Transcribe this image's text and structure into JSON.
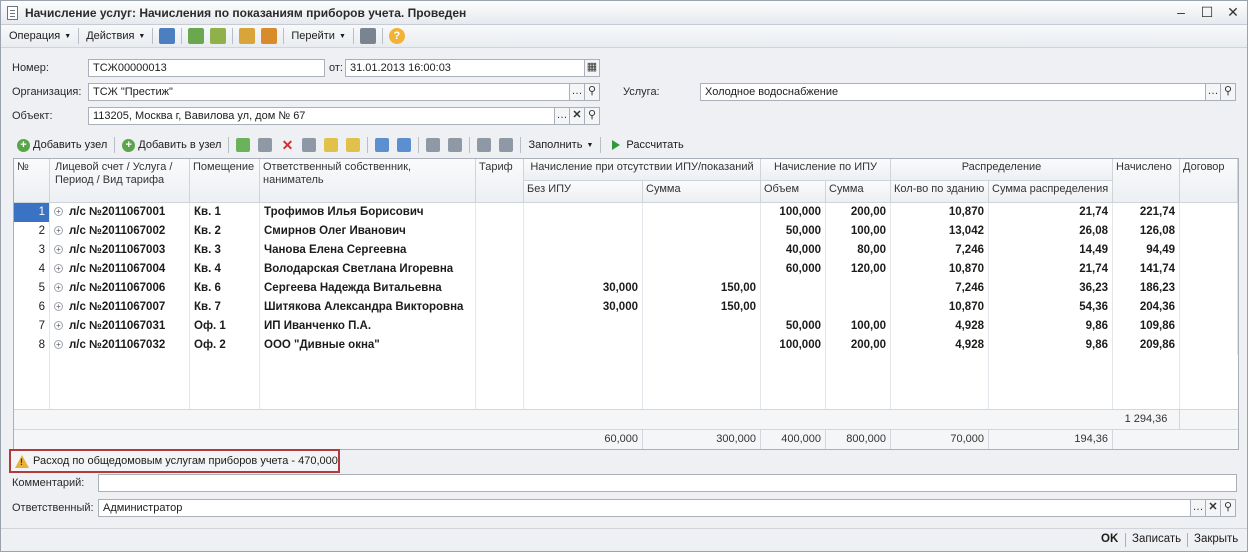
{
  "window": {
    "title": "Начисление услуг: Начисления по показаниям приборов учета. Проведен"
  },
  "toolbar": {
    "operation": "Операция",
    "actions": "Действия",
    "goto": "Перейти"
  },
  "form": {
    "number_label": "Номер:",
    "number": "ТСЖ00000013",
    "date_label": "от:",
    "date": "31.01.2013 16:00:03",
    "org_label": "Организация:",
    "org": "ТСЖ \"Престиж\"",
    "service_label": "Услуга:",
    "service": "Холодное водоснабжение",
    "object_label": "Объект:",
    "object": "113205, Москва г, Вавилова ул, дом № 67"
  },
  "gridbar": {
    "add_node": "Добавить узел",
    "add_to_node": "Добавить в узел",
    "fill": "Заполнить",
    "calculate": "Рассчитать"
  },
  "columns": {
    "num": "№",
    "account": "Лицевой счет / Услуга / Период / Вид тарифа",
    "room": "Помещение",
    "owner": "Ответственный собственник, наниматель",
    "tariff": "Тариф",
    "no_ipu": "Начисление при отсутствии ИПУ/показаний",
    "no_ipu_without": "Без ИПУ",
    "no_ipu_sum": "Сумма",
    "ipu": "Начисление по ИПУ",
    "ipu_volume": "Объем",
    "ipu_sum": "Сумма",
    "distribution": "Распределение",
    "dist_qty": "Кол-во по зданию",
    "dist_sum": "Сумма распределения",
    "charged": "Начислено",
    "contract": "Договор"
  },
  "rows": [
    {
      "n": "1",
      "account": "л/с №2011067001",
      "room": "Кв. 1",
      "owner": "Трофимов Илья Борисович",
      "noipu": "",
      "noipu_sum": "",
      "vol": "100,000",
      "ipusum": "200,00",
      "qty": "10,870",
      "dsum": "21,74",
      "charged": "221,74"
    },
    {
      "n": "2",
      "account": "л/с №2011067002",
      "room": "Кв. 2",
      "owner": "Смирнов Олег Иванович",
      "noipu": "",
      "noipu_sum": "",
      "vol": "50,000",
      "ipusum": "100,00",
      "qty": "13,042",
      "dsum": "26,08",
      "charged": "126,08"
    },
    {
      "n": "3",
      "account": "л/с №2011067003",
      "room": "Кв. 3",
      "owner": "Чанова Елена Сергеевна",
      "noipu": "",
      "noipu_sum": "",
      "vol": "40,000",
      "ipusum": "80,00",
      "qty": "7,246",
      "dsum": "14,49",
      "charged": "94,49"
    },
    {
      "n": "4",
      "account": "л/с №2011067004",
      "room": "Кв. 4",
      "owner": "Володарская Светлана Игоревна",
      "noipu": "",
      "noipu_sum": "",
      "vol": "60,000",
      "ipusum": "120,00",
      "qty": "10,870",
      "dsum": "21,74",
      "charged": "141,74"
    },
    {
      "n": "5",
      "account": "л/с №2011067006",
      "room": "Кв. 6",
      "owner": "Сергеева Надежда Витальевна",
      "noipu": "30,000",
      "noipu_sum": "150,00",
      "vol": "",
      "ipusum": "",
      "qty": "7,246",
      "dsum": "36,23",
      "charged": "186,23"
    },
    {
      "n": "6",
      "account": "л/с №2011067007",
      "room": "Кв. 7",
      "owner": "Шитякова Александра Викторовна",
      "noipu": "30,000",
      "noipu_sum": "150,00",
      "vol": "",
      "ipusum": "",
      "qty": "10,870",
      "dsum": "54,36",
      "charged": "204,36"
    },
    {
      "n": "7",
      "account": "л/с №2011067031",
      "room": "Оф. 1",
      "owner": "ИП Иванченко П.А.",
      "noipu": "",
      "noipu_sum": "",
      "vol": "50,000",
      "ipusum": "100,00",
      "qty": "4,928",
      "dsum": "9,86",
      "charged": "109,86"
    },
    {
      "n": "8",
      "account": "л/с №2011067032",
      "room": "Оф. 2",
      "owner": "ООО \"Дивные окна\"",
      "noipu": "",
      "noipu_sum": "",
      "vol": "100,000",
      "ipusum": "200,00",
      "qty": "4,928",
      "dsum": "9,86",
      "charged": "209,86"
    }
  ],
  "totals": {
    "charged": "1 294,36",
    "noipu": "60,000",
    "noipu_sum": "300,000",
    "vol": "400,000",
    "ipusum": "800,000",
    "qty": "70,000",
    "dsum": "194,36"
  },
  "warning": "Расход по общедомовым услугам приборов учета - 470,000",
  "comment_label": "Комментарий:",
  "comment": "",
  "responsible_label": "Ответственный:",
  "responsible": "Администратор",
  "bottom": {
    "ok": "OK",
    "save": "Записать",
    "close": "Закрыть"
  }
}
